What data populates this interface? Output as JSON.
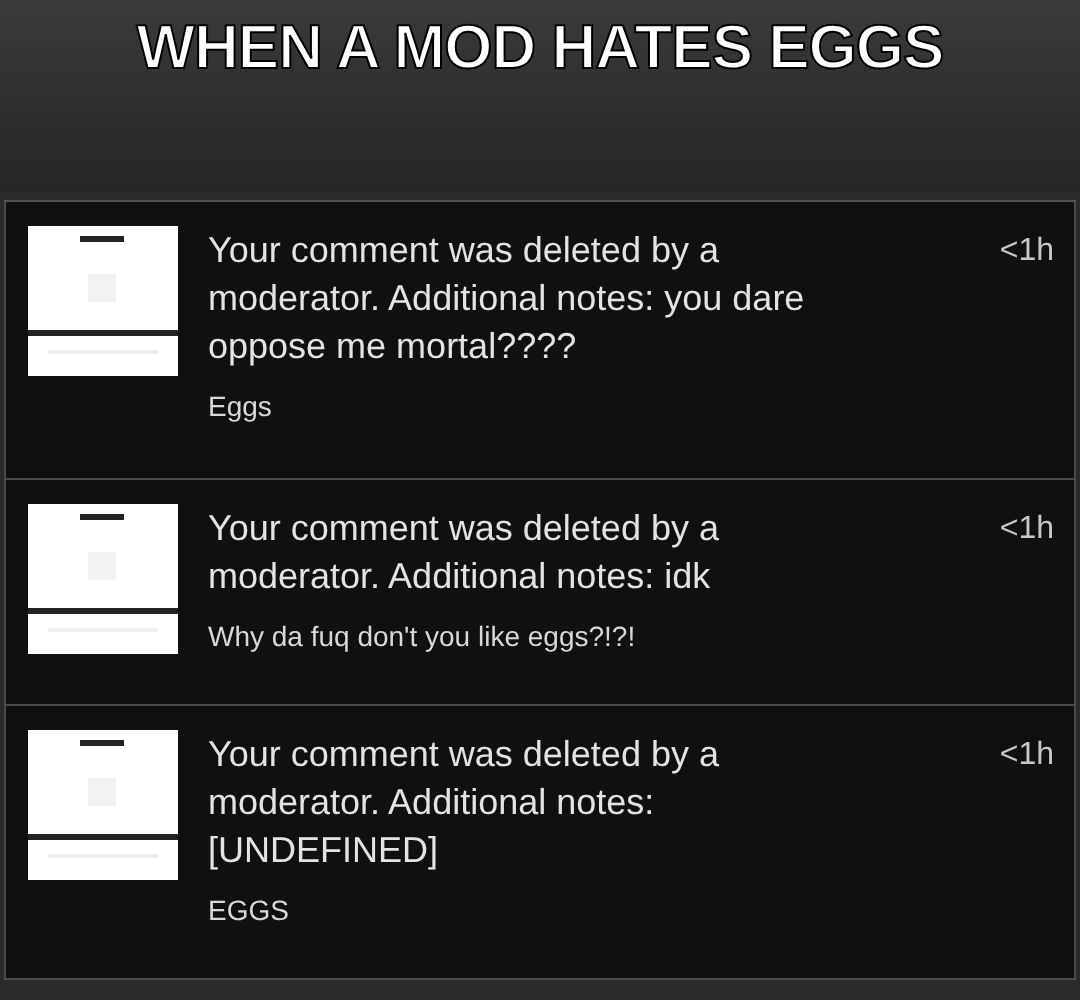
{
  "caption": "WHEN A MOD HATES EGGS",
  "notifications": [
    {
      "title": "Your comment was deleted by a moderator. Additional notes: you dare oppose me mortal????",
      "time": "<1h",
      "comment": "Eggs"
    },
    {
      "title": "Your comment was deleted by a moderator. Additional notes: idk",
      "time": "<1h",
      "comment": "Why da fuq don't you like eggs?!?!"
    },
    {
      "title": "Your comment was deleted by a moderator. Additional notes: [UNDEFINED]",
      "time": "<1h",
      "comment": "EGGS"
    }
  ]
}
